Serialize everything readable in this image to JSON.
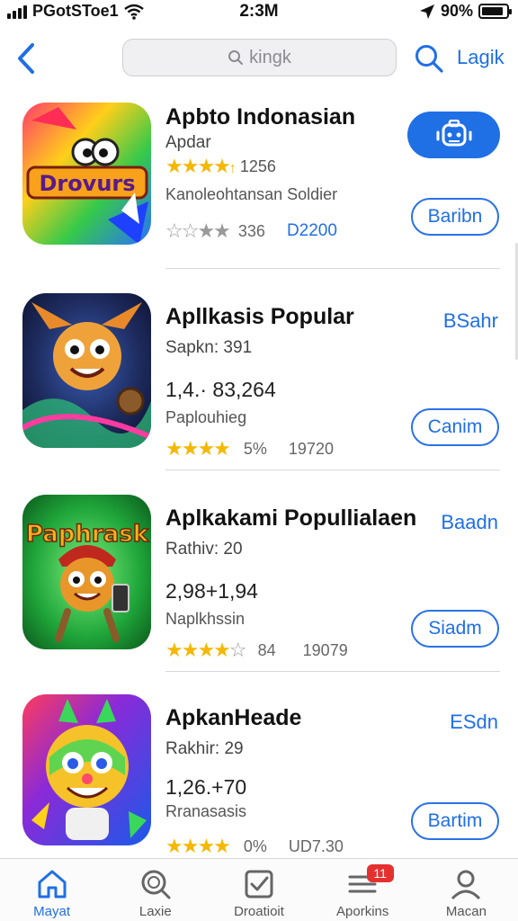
{
  "status": {
    "carrier": "PGotSToe1",
    "time": "2:3M",
    "battery_text": "90%",
    "battery_level": 0.9
  },
  "nav": {
    "search_placeholder": "kingk",
    "action_label": "Lagik"
  },
  "apps": [
    {
      "name": "Apbto Indonasian",
      "line1": "Apdar",
      "rating_count": "1256",
      "line3": "Kanoleohtansan Soldier",
      "stars_text": "336",
      "price": "D2200",
      "button_label": "Baribn",
      "icon_text": "Drovurs"
    },
    {
      "name": "Apllkasis Popular",
      "top_action": "BSahr",
      "line1": "Sapkn: 391",
      "line2": "1,4.· 83,264",
      "line3": "Paplouhieg",
      "rating_count": "5%",
      "extra": "19720",
      "button_label": "Canim"
    },
    {
      "name": "Aplkakami Popullialaen",
      "top_action": "Baadn",
      "line1": "Rathiv: 20",
      "line2": "2,98+1,94",
      "line3": "Naplkhssin",
      "rating_count": "84",
      "extra": "19079",
      "button_label": "Siadm",
      "icon_text": "Paphrask"
    },
    {
      "name": "ApkanHeade",
      "top_action": "ESdn",
      "line1": "Rakhir: 29",
      "line2": "1,26.+70",
      "line3": "Rranasasis",
      "rating_count": "0%",
      "extra": "UD7.30",
      "button_label": "Bartim"
    }
  ],
  "tabs": [
    {
      "label": "Mayat",
      "icon": "home-icon"
    },
    {
      "label": "Laxie",
      "icon": "search-icon"
    },
    {
      "label": "Droatioit",
      "icon": "checkbox-icon"
    },
    {
      "label": "Aporkins",
      "icon": "list-icon",
      "badge": "11"
    },
    {
      "label": "Macan",
      "icon": "person-icon"
    }
  ],
  "colors": {
    "accent": "#1f6fe5",
    "star": "#f5b800",
    "badge": "#e53030"
  }
}
